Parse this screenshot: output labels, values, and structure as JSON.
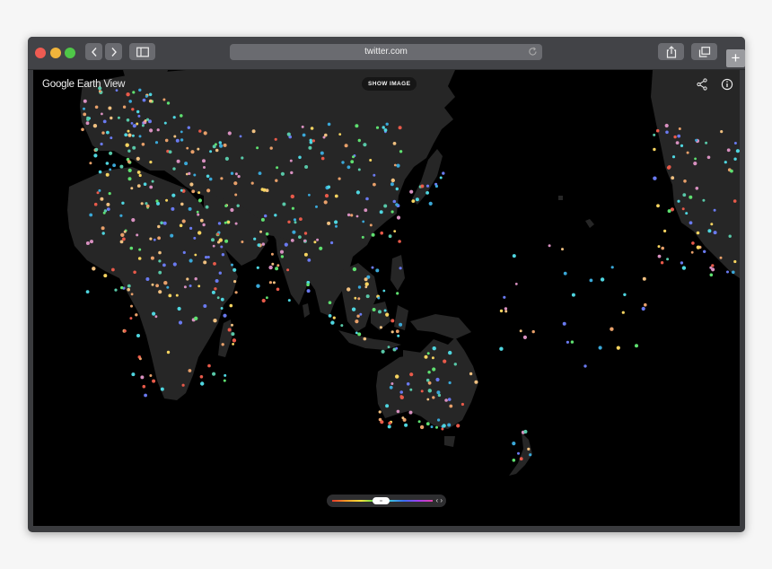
{
  "browser": {
    "address": "twitter.com",
    "new_tab_label": "+"
  },
  "app": {
    "logo_google": "Google",
    "logo_product": "Earth View",
    "show_image_label": "SHOW IMAGE"
  },
  "icons": {
    "back": "chevron-left-icon",
    "forward": "chevron-right-icon",
    "sidebar": "sidebar-icon",
    "share": "share-icon",
    "tabs": "tabs-icon",
    "map_share": "share-nodes-icon",
    "info": "info-icon",
    "reload": "reload-icon"
  },
  "colors": {
    "land": "#262626",
    "ocean": "#000000",
    "dots": [
      "#e8a06a",
      "#f0c080",
      "#4fd6e0",
      "#3aa8d8",
      "#5fe070",
      "#e85a4a",
      "#d890c0",
      "#6a7af0",
      "#f7d460",
      "#58c8a8"
    ]
  },
  "slider": {
    "arrows": "‹ ›"
  }
}
